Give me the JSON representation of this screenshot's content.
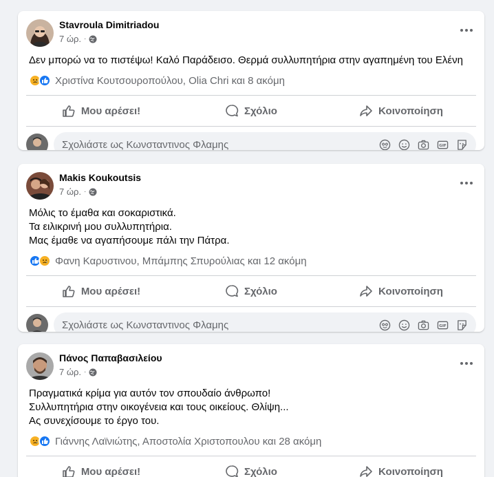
{
  "composer": {
    "placeholder": "Σχολιάστε ως Κωνσταντινος Φλαμης"
  },
  "actions": {
    "like": "Μου αρέσει!",
    "comment": "Σχόλιο",
    "share": "Κοινοποίηση"
  },
  "posts": [
    {
      "author": "Stavroula Dimitriadou",
      "time": "7 ώρ.",
      "lines": [
        "Δεν μπορώ να το πιστέψω! Καλό Παράδεισο. Θερμά συλλυπητήρια στην αγαπημένη του Ελένη"
      ],
      "reactions_text": "Χριστίνα Κουτσουροπούλου, Olia Chri και 8 ακόμη",
      "reaction_icons": [
        "sad-icon",
        "like-icon"
      ]
    },
    {
      "author": "Makis Koukoutsis",
      "time": "7 ώρ.",
      "lines": [
        "Μόλις το έμαθα και σοκαριστικά.",
        "Τα ειλικρινή μου συλλυπητήρια.",
        "Μας έμαθε να αγαπήσουμε πάλι την Πάτρα."
      ],
      "reactions_text": "Φανη Καρυστινου, Μπάμπης Σπυρούλιας και 12 ακόμη",
      "reaction_icons": [
        "like-icon",
        "sad-icon"
      ]
    },
    {
      "author": "Πάνος Παπαβασιλείου",
      "time": "7 ώρ.",
      "lines": [
        "Πραγματικά κρίμα για αυτόν τον σπουδαίο άνθρωπο!",
        "Συλλυπητήρια στην οικογένεια και τους οικείους. Θλίψη...",
        "Ας συνεχίσουμε το έργο του."
      ],
      "reactions_text": "Γιάννης Λαϊνιώτης, Αποστολία Χριστοπουλου και 28 ακόμη",
      "reaction_icons": [
        "sad-icon",
        "like-icon"
      ]
    }
  ],
  "colors": {
    "background": "#f0f2f5",
    "card": "#ffffff",
    "secondary_text": "#65676b",
    "like_blue": "#1877f2",
    "sad_yellow": "#f7b125"
  }
}
